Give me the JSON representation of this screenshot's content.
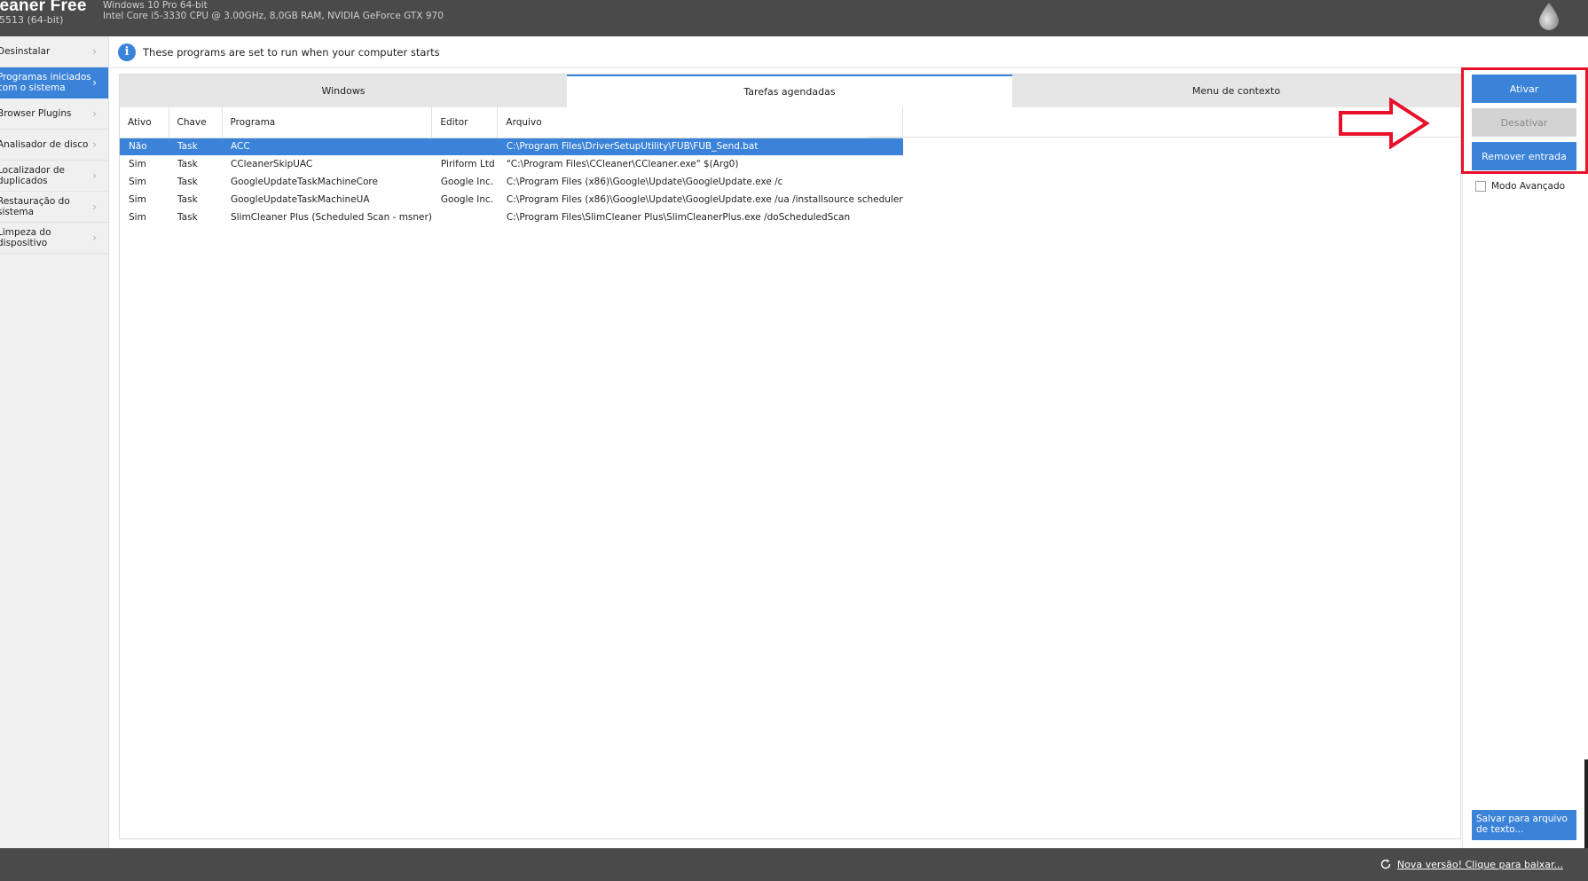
{
  "header": {
    "app_title": "leaner Free",
    "app_version": "5513 (64-bit)",
    "sys_line1": "Windows 10 Pro 64-bit",
    "sys_line2": "Intel Core i5-3330 CPU @ 3.00GHz, 8,0GB RAM, NVIDIA GeForce GTX 970",
    "logo_icon": "droplet-logo-icon"
  },
  "sidebar": {
    "items": [
      {
        "label": "Desinstalar",
        "active": false
      },
      {
        "label": "Programas iniciados com o sistema",
        "active": true
      },
      {
        "label": "Browser Plugins",
        "active": false
      },
      {
        "label": "Analisador de disco",
        "active": false
      },
      {
        "label": "Localizador de duplicados",
        "active": false
      },
      {
        "label": "Restauração do sistema",
        "active": false
      },
      {
        "label": "Limpeza do dispositivo",
        "active": false
      }
    ]
  },
  "info": {
    "icon": "info-icon",
    "text": "These programs are set to run when your computer starts"
  },
  "tabs": [
    {
      "label": "Windows",
      "active": false
    },
    {
      "label": "Tarefas agendadas",
      "active": true
    },
    {
      "label": "Menu de contexto",
      "active": false
    }
  ],
  "table": {
    "columns": [
      "Ativo",
      "Chave",
      "Programa",
      "Editor",
      "Arquivo"
    ],
    "rows": [
      {
        "ativo": "Não",
        "chave": "Task",
        "programa": "ACC",
        "editor": "",
        "arquivo": "C:\\Program Files\\DriverSetupUtility\\FUB\\FUB_Send.bat",
        "selected": true
      },
      {
        "ativo": "Sim",
        "chave": "Task",
        "programa": "CCleanerSkipUAC",
        "editor": "Piriform Ltd",
        "arquivo": "\"C:\\Program Files\\CCleaner\\CCleaner.exe\" $(Arg0)",
        "selected": false
      },
      {
        "ativo": "Sim",
        "chave": "Task",
        "programa": "GoogleUpdateTaskMachineCore",
        "editor": "Google Inc.",
        "arquivo": "C:\\Program Files (x86)\\Google\\Update\\GoogleUpdate.exe /c",
        "selected": false
      },
      {
        "ativo": "Sim",
        "chave": "Task",
        "programa": "GoogleUpdateTaskMachineUA",
        "editor": "Google Inc.",
        "arquivo": "C:\\Program Files (x86)\\Google\\Update\\GoogleUpdate.exe /ua /installsource scheduler",
        "selected": false
      },
      {
        "ativo": "Sim",
        "chave": "Task",
        "programa": "SlimCleaner Plus (Scheduled Scan - msner)",
        "editor": "",
        "arquivo": "C:\\Program Files\\SlimCleaner Plus\\SlimCleanerPlus.exe /doScheduledScan",
        "selected": false
      }
    ]
  },
  "actions": {
    "ativar": "Ativar",
    "desativar": "Desativar",
    "remover": "Remover entrada",
    "modo_avancado": "Modo Avançado",
    "salvar": "Salvar para arquivo de texto..."
  },
  "footer": {
    "update_icon": "refresh-icon",
    "update_text": "Nova versão! Clique para baixar..."
  },
  "colors": {
    "accent": "#3b82d9",
    "header_bg": "#4a4a4a",
    "highlight_red": "#e8102a"
  }
}
